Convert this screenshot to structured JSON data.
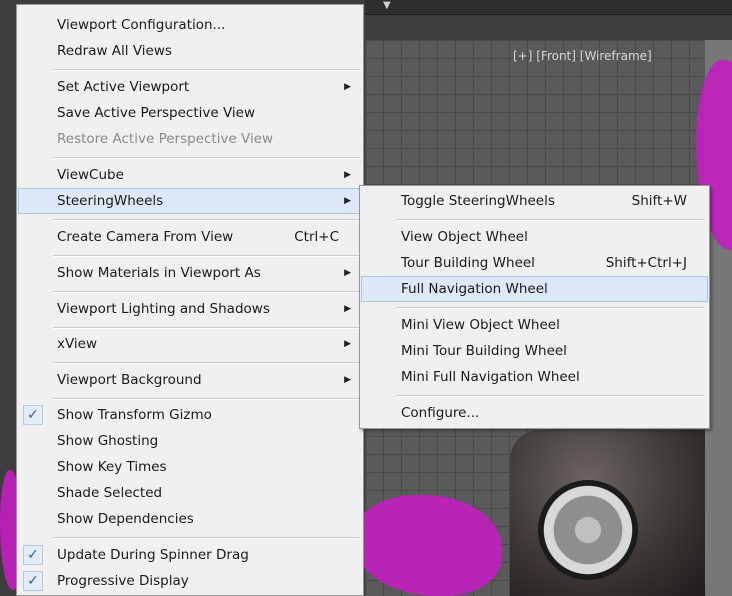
{
  "viewport": {
    "label": "[+] [Front] [Wireframe]"
  },
  "main_menu": {
    "items": [
      {
        "label": "Viewport Configuration...",
        "shortcut": "",
        "submenu": false,
        "checked": false,
        "disabled": false
      },
      {
        "label": "Redraw All Views",
        "shortcut": "",
        "submenu": false,
        "checked": false,
        "disabled": false
      },
      {
        "label": "Set Active Viewport",
        "shortcut": "",
        "submenu": true,
        "checked": false,
        "disabled": false
      },
      {
        "label": "Save Active Perspective View",
        "shortcut": "",
        "submenu": false,
        "checked": false,
        "disabled": false
      },
      {
        "label": "Restore Active Perspective View",
        "shortcut": "",
        "submenu": false,
        "checked": false,
        "disabled": true
      },
      {
        "label": "ViewCube",
        "shortcut": "",
        "submenu": true,
        "checked": false,
        "disabled": false
      },
      {
        "label": "SteeringWheels",
        "shortcut": "",
        "submenu": true,
        "checked": false,
        "disabled": false,
        "highlighted": true
      },
      {
        "label": "Create Camera From View",
        "shortcut": "Ctrl+C",
        "submenu": false,
        "checked": false,
        "disabled": false
      },
      {
        "label": "Show Materials in Viewport As",
        "shortcut": "",
        "submenu": true,
        "checked": false,
        "disabled": false
      },
      {
        "label": "Viewport Lighting and Shadows",
        "shortcut": "",
        "submenu": true,
        "checked": false,
        "disabled": false
      },
      {
        "label": "xView",
        "shortcut": "",
        "submenu": true,
        "checked": false,
        "disabled": false
      },
      {
        "label": "Viewport Background",
        "shortcut": "",
        "submenu": true,
        "checked": false,
        "disabled": false
      },
      {
        "label": "Show Transform Gizmo",
        "shortcut": "",
        "submenu": false,
        "checked": true,
        "disabled": false
      },
      {
        "label": "Show Ghosting",
        "shortcut": "",
        "submenu": false,
        "checked": false,
        "disabled": false
      },
      {
        "label": "Show Key Times",
        "shortcut": "",
        "submenu": false,
        "checked": false,
        "disabled": false
      },
      {
        "label": "Shade Selected",
        "shortcut": "",
        "submenu": false,
        "checked": false,
        "disabled": false
      },
      {
        "label": "Show Dependencies",
        "shortcut": "",
        "submenu": false,
        "checked": false,
        "disabled": false
      },
      {
        "label": "Update During Spinner Drag",
        "shortcut": "",
        "submenu": false,
        "checked": true,
        "disabled": false
      },
      {
        "label": "Progressive Display",
        "shortcut": "",
        "submenu": false,
        "checked": true,
        "disabled": false
      }
    ]
  },
  "steering_submenu": {
    "items": [
      {
        "label": "Toggle SteeringWheels",
        "shortcut": "Shift+W"
      },
      {
        "label": "View Object Wheel",
        "shortcut": ""
      },
      {
        "label": "Tour Building Wheel",
        "shortcut": "Shift+Ctrl+J"
      },
      {
        "label": "Full Navigation Wheel",
        "shortcut": "",
        "highlighted": true
      },
      {
        "label": "Mini View Object Wheel",
        "shortcut": ""
      },
      {
        "label": "Mini Tour Building Wheel",
        "shortcut": ""
      },
      {
        "label": "Mini Full Navigation Wheel",
        "shortcut": ""
      },
      {
        "label": "Configure...",
        "shortcut": ""
      }
    ]
  },
  "glyphs": {
    "check": "✓",
    "submenu_arrow": "▶",
    "dropdown": "▼"
  },
  "colors": {
    "menu_bg": "#f0f0f0",
    "highlight": "#dde8f8",
    "disabled_text": "#8a8a8a",
    "check_blue": "#2b62b8",
    "wireframe_magenta": "#c21fc0"
  }
}
